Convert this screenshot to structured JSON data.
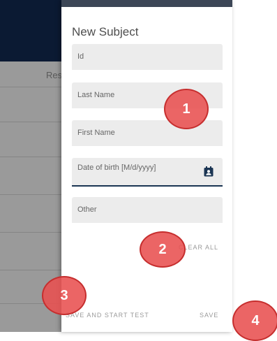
{
  "background": {
    "partial_title": "Res"
  },
  "panel": {
    "title": "New Subject",
    "fields": {
      "id": {
        "placeholder": "Id"
      },
      "last_name": {
        "placeholder": "Last Name"
      },
      "first_name": {
        "placeholder": "First Name"
      },
      "date_of_birth": {
        "placeholder": "Date of birth   [M/d/yyyy]"
      },
      "other": {
        "placeholder": "Other"
      }
    },
    "actions": {
      "clear_all": "CLEAR ALL",
      "save_and_start_test": "SAVE AND START TEST",
      "save": "SAVE"
    }
  },
  "callouts": [
    "1",
    "2",
    "3",
    "4"
  ],
  "colors": {
    "accent": "#1b3553",
    "callout": "#e85050",
    "header": "#0b1a33"
  }
}
